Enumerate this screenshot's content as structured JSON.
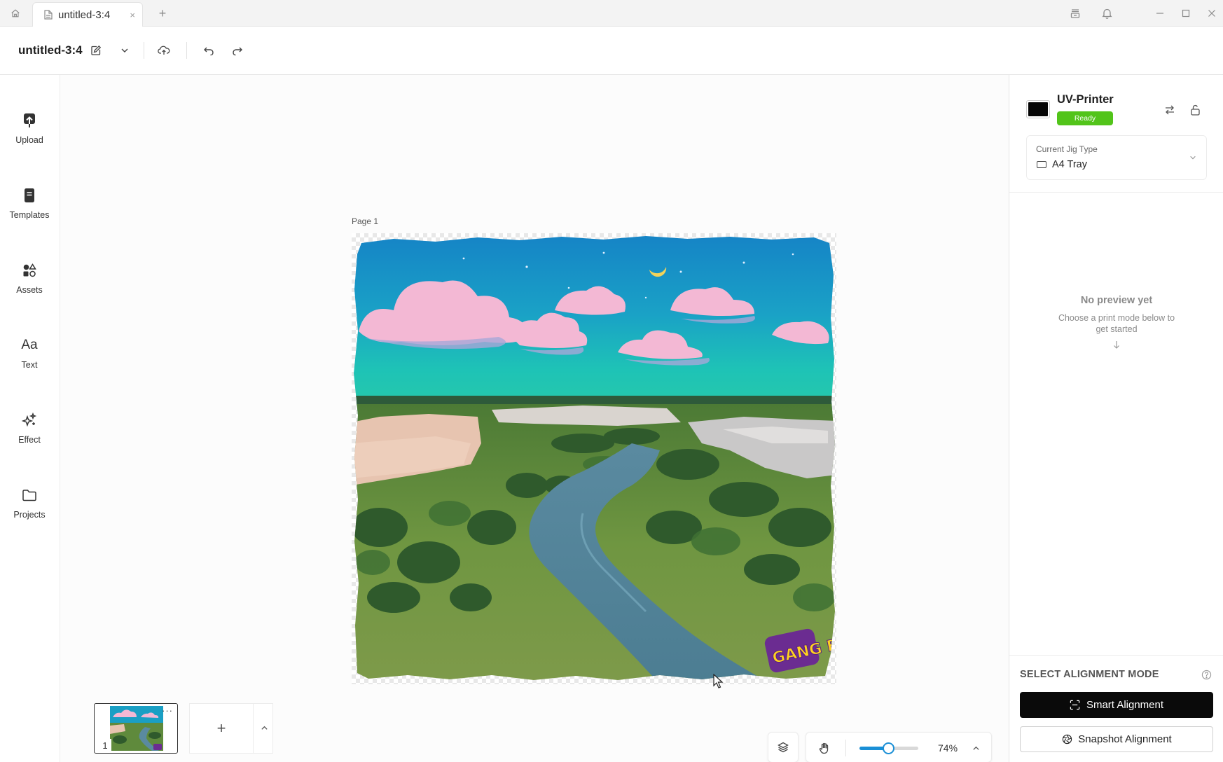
{
  "tabs": [
    {
      "label": "untitled-3:4",
      "close": "×"
    }
  ],
  "new_tab": "+",
  "toolbar": {
    "doc_title": "untitled-3:4"
  },
  "sidebar": {
    "items": [
      {
        "label": "Upload",
        "icon": "upload-icon"
      },
      {
        "label": "Templates",
        "icon": "templates-icon"
      },
      {
        "label": "Assets",
        "icon": "assets-icon"
      },
      {
        "label": "Text",
        "icon": "text-icon",
        "glyph": "Aa"
      },
      {
        "label": "Effect",
        "icon": "sparkle-icon"
      },
      {
        "label": "Projects",
        "icon": "folder-icon"
      }
    ]
  },
  "canvas": {
    "page_label": "Page 1",
    "artwork_logo_text": "GANG BAIRY"
  },
  "zoom": {
    "value": "74%",
    "level": 0.5
  },
  "pages": {
    "thumbnails": [
      {
        "number": "1",
        "more": "···"
      }
    ],
    "add_symbol": "+"
  },
  "printer": {
    "name": "UV-Printer",
    "status": "Ready",
    "status_color": "#52c41a"
  },
  "jig": {
    "title": "Current Jig Type",
    "value": "A4 Tray"
  },
  "preview": {
    "title": "No preview yet",
    "description": "Choose a print mode below to get started"
  },
  "alignment": {
    "title": "SELECT ALIGNMENT MODE",
    "smart_label": "Smart Alignment",
    "snapshot_label": "Snapshot Alignment"
  },
  "colors": {
    "accent": "#1a8fd6",
    "primary_button": "#0a0a0a"
  }
}
